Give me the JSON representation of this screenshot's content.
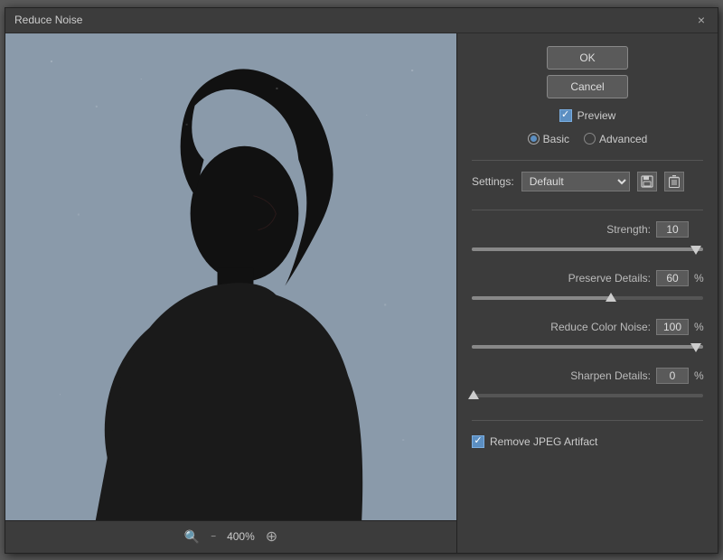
{
  "dialog": {
    "title": "Reduce Noise",
    "close_label": "×"
  },
  "buttons": {
    "ok_label": "OK",
    "cancel_label": "Cancel"
  },
  "preview": {
    "label": "Preview",
    "checked": true
  },
  "mode": {
    "options": [
      "Basic",
      "Advanced"
    ],
    "selected": "Basic"
  },
  "settings": {
    "label": "Settings:",
    "value": "Default",
    "options": [
      "Default"
    ],
    "save_icon": "💾",
    "delete_icon": "🗑"
  },
  "params": {
    "strength": {
      "label": "Strength:",
      "value": "10",
      "unit": "",
      "percent": 100
    },
    "preserve_details": {
      "label": "Preserve Details:",
      "value": "60",
      "unit": "%",
      "percent": 60
    },
    "reduce_color_noise": {
      "label": "Reduce Color Noise:",
      "value": "100",
      "unit": "%",
      "percent": 100
    },
    "sharpen_details": {
      "label": "Sharpen Details:",
      "value": "0",
      "unit": "%",
      "percent": 0
    }
  },
  "remove_jpeg": {
    "label": "Remove JPEG Artifact",
    "checked": true
  },
  "zoom": {
    "level": "400%"
  }
}
